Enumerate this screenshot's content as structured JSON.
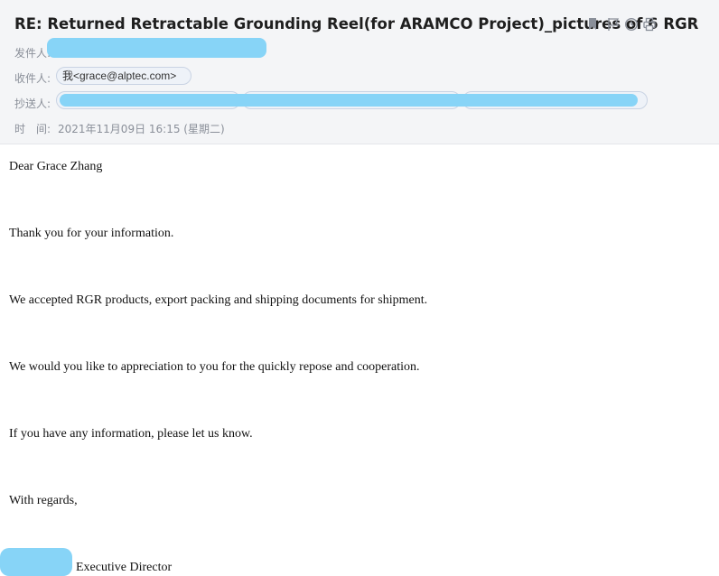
{
  "header": {
    "subject": "RE: Returned Retractable Grounding Reel(for ARAMCO Project)_pictures of 6 RGR",
    "from_label": "发件人:",
    "to_label": "收件人:",
    "to_chip": "我<grace@alptec.com>",
    "cc_label": "抄送人:",
    "time_label": "时　间:",
    "time_value": "2021年11月09日 16:15 (星期二)"
  },
  "toolbar": {
    "icons": [
      "bookmark-icon",
      "flag-icon",
      "clock-icon",
      "print-icon"
    ]
  },
  "body": {
    "greeting": "Dear Grace Zhang",
    "p1": "Thank you for your information.",
    "p2": "We accepted RGR products, export packing and shipping documents for shipment.",
    "p3": "We would you like to appreciation to you for the quickly repose and cooperation.",
    "p4": "If you have any information, please let us know.",
    "closing": "With regards,",
    "signature_title": "Executive Director"
  },
  "colors": {
    "header_bg": "#f4f5f7",
    "redaction": "#87d4f7",
    "chip_bg": "#eef2f8",
    "chip_border": "#c9d3e3"
  }
}
